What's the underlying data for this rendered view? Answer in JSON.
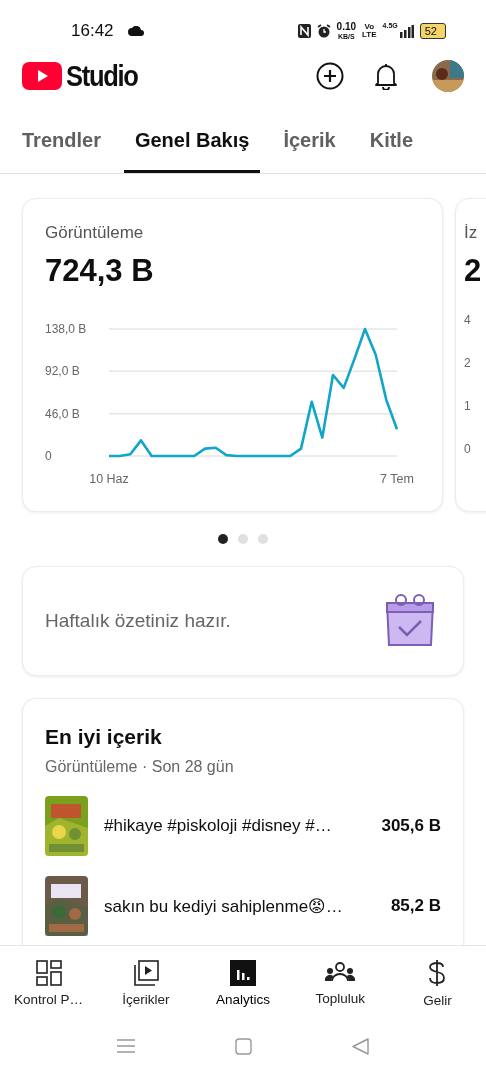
{
  "status_bar": {
    "time": "16:42",
    "speed": "0.10",
    "speed_unit": "KB/S",
    "volte_top": "Vo",
    "volte_bottom": "LTE",
    "network": "4.5G",
    "battery": "52"
  },
  "header": {
    "logo_text": "Studio"
  },
  "tabs": [
    {
      "label": "Trendler",
      "selected": false
    },
    {
      "label": "Genel Bakış",
      "selected": true
    },
    {
      "label": "İçerik",
      "selected": false
    },
    {
      "label": "Kitle",
      "selected": false
    }
  ],
  "metric_cards": [
    {
      "title": "Görüntüleme",
      "value": "724,3 B",
      "chart_data": {
        "type": "line",
        "yticks": [
          {
            "value": 138,
            "label": "138,0 B"
          },
          {
            "value": 92,
            "label": "92,0 B"
          },
          {
            "value": 46,
            "label": "46,0 B"
          },
          {
            "value": 0,
            "label": "0"
          }
        ],
        "ylim": [
          0,
          138
        ],
        "categories": [
          "10 Haz",
          null,
          null,
          null,
          null,
          null,
          null,
          null,
          null,
          null,
          null,
          null,
          null,
          null,
          null,
          null,
          null,
          null,
          null,
          null,
          null,
          null,
          null,
          null,
          null,
          null,
          null,
          "7 Tem"
        ],
        "series": [
          {
            "color": "#10a5c9",
            "values": [
              0,
              0,
              2,
              17,
              0,
              0,
              0,
              0,
              0,
              8,
              9,
              1,
              0,
              0,
              0,
              0,
              0,
              0,
              8,
              59,
              20,
              88,
              74,
              105,
              138,
              110,
              61,
              29
            ]
          }
        ]
      }
    }
  ],
  "peek_card": {
    "title": "İz",
    "value": "2",
    "ticks": [
      "4",
      "2",
      "1",
      "0"
    ]
  },
  "carousel_dots": [
    {
      "selected": true
    },
    {
      "selected": false
    },
    {
      "selected": false
    }
  ],
  "weekly_card": {
    "text": "Haftalık özetiniz hazır."
  },
  "top_content": {
    "title": "En iyi içerik",
    "subtitle": "Görüntüleme · Son 28 gün",
    "items": [
      {
        "kind": "picture",
        "title": "#hikaye #piskoloji #disney #…",
        "views": "305,6 B"
      },
      {
        "kind": "picture",
        "title": "sakın bu kediyi sahiplenme😡…",
        "views": "85,2 B"
      }
    ]
  },
  "bottom_nav": [
    {
      "label": "Kontrol P…",
      "selected": false
    },
    {
      "label": "İçerikler",
      "selected": false
    },
    {
      "label": "Analytics",
      "selected": true
    },
    {
      "label": "Topluluk",
      "selected": false
    },
    {
      "label": "Gelir",
      "selected": false
    }
  ]
}
